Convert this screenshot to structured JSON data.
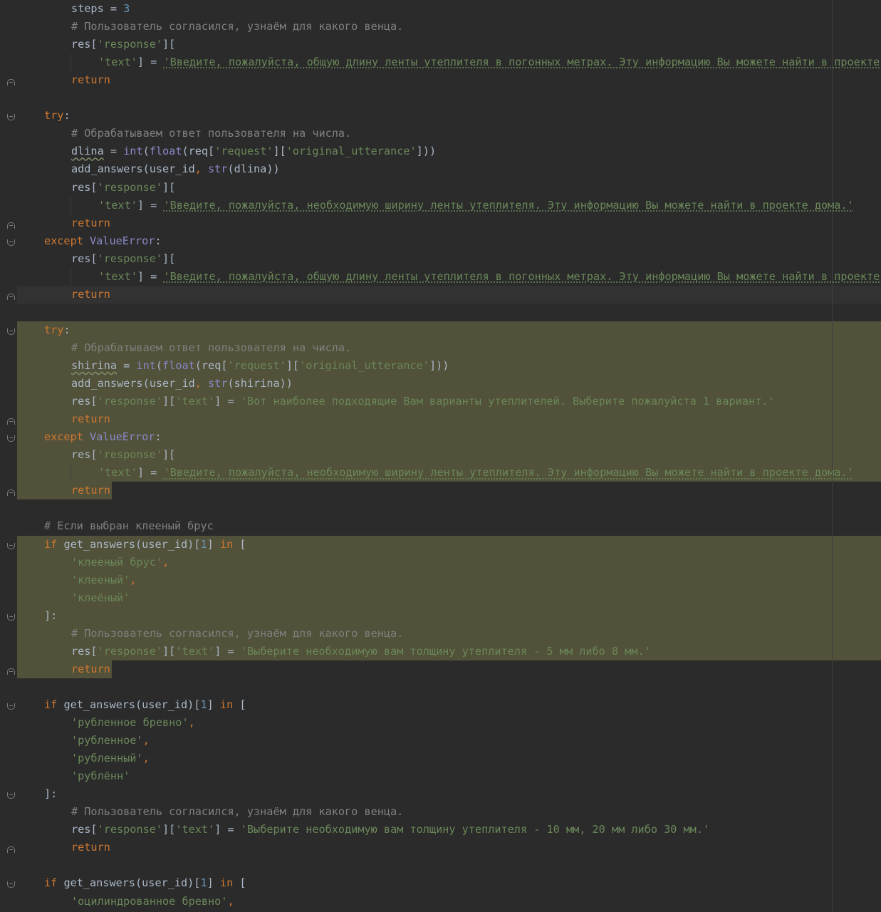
{
  "editor": {
    "language": "python",
    "lines": [
      {
        "indent": 2,
        "tokens": [
          [
            "",
            "steps "
          ],
          [
            "",
            "= "
          ],
          [
            "num",
            "3"
          ]
        ]
      },
      {
        "indent": 2,
        "tokens": [
          [
            "cmt",
            "# Пользователь согласился, узнаём для какого венца."
          ]
        ]
      },
      {
        "indent": 2,
        "tokens": [
          [
            "",
            "res["
          ],
          [
            "str",
            "'response'"
          ],
          [
            "",
            "]["
          ]
        ]
      },
      {
        "indent": 3,
        "tokens": [
          [
            "str",
            "'text'"
          ],
          [
            "",
            "] = "
          ],
          [
            "str und",
            "'Введите, пожалуйста, общую длину ленты утеплителя в погонных метрах. Эту информацию Вы можете найти в проекте дома'"
          ]
        ]
      },
      {
        "indent": 2,
        "tokens": [
          [
            "kw",
            "return"
          ]
        ]
      },
      {
        "indent": 0,
        "tokens": []
      },
      {
        "indent": 1,
        "tokens": [
          [
            "kw",
            "try"
          ],
          [
            "",
            ":"
          ]
        ]
      },
      {
        "indent": 2,
        "tokens": [
          [
            "cmt",
            "# Обрабатываем ответ пользователя на числа."
          ]
        ]
      },
      {
        "indent": 2,
        "tokens": [
          [
            "warn",
            "dlina"
          ],
          [
            "",
            " = "
          ],
          [
            "bi",
            "int"
          ],
          [
            "",
            "("
          ],
          [
            "bi",
            "float"
          ],
          [
            "",
            "(req["
          ],
          [
            "str",
            "'request'"
          ],
          [
            "",
            "]["
          ],
          [
            "str",
            "'original_utterance'"
          ],
          [
            "",
            "]))"
          ]
        ]
      },
      {
        "indent": 2,
        "tokens": [
          [
            "",
            "add_answers(user_id"
          ],
          [
            "kw",
            ", "
          ],
          [
            "bi",
            "str"
          ],
          [
            "",
            "(dlina))"
          ]
        ]
      },
      {
        "indent": 2,
        "tokens": [
          [
            "",
            "res["
          ],
          [
            "str",
            "'response'"
          ],
          [
            "",
            "]["
          ]
        ]
      },
      {
        "indent": 3,
        "tokens": [
          [
            "str",
            "'text'"
          ],
          [
            "",
            "] = "
          ],
          [
            "str und",
            "'Введите, пожалуйста, необходимую ширину ленты утеплителя. Эту информацию Вы можете найти в проекте дома.'"
          ]
        ]
      },
      {
        "indent": 2,
        "tokens": [
          [
            "kw",
            "return"
          ]
        ]
      },
      {
        "indent": 1,
        "tokens": [
          [
            "kw",
            "except "
          ],
          [
            "bi",
            "ValueError"
          ],
          [
            "",
            ":"
          ]
        ]
      },
      {
        "indent": 2,
        "tokens": [
          [
            "",
            "res["
          ],
          [
            "str",
            "'response'"
          ],
          [
            "",
            "]["
          ]
        ]
      },
      {
        "indent": 3,
        "tokens": [
          [
            "str",
            "'text'"
          ],
          [
            "",
            "] = "
          ],
          [
            "str und",
            "'Введите, пожалуйста, общую длину ленты утеплителя в погонных метрах. Эту информацию Вы можете найти в проекте дома'"
          ]
        ]
      },
      {
        "indent": 2,
        "tokens": [
          [
            "kw",
            "return"
          ]
        ]
      },
      {
        "indent": 0,
        "tokens": []
      },
      {
        "indent": 1,
        "tokens": [
          [
            "kw",
            "try"
          ],
          [
            "",
            ":"
          ]
        ]
      },
      {
        "indent": 2,
        "tokens": [
          [
            "cmt",
            "# Обрабатываем ответ пользователя на числа."
          ]
        ]
      },
      {
        "indent": 2,
        "tokens": [
          [
            "warn",
            "shirina"
          ],
          [
            "",
            " = "
          ],
          [
            "bi",
            "int"
          ],
          [
            "",
            "("
          ],
          [
            "bi",
            "float"
          ],
          [
            "",
            "(req["
          ],
          [
            "str",
            "'request'"
          ],
          [
            "",
            "]["
          ],
          [
            "str",
            "'original_utterance'"
          ],
          [
            "",
            "]))"
          ]
        ]
      },
      {
        "indent": 2,
        "tokens": [
          [
            "",
            "add_answers(user_id"
          ],
          [
            "kw",
            ", "
          ],
          [
            "bi",
            "str"
          ],
          [
            "",
            "(shirina))"
          ]
        ]
      },
      {
        "indent": 2,
        "tokens": [
          [
            "",
            "res["
          ],
          [
            "str",
            "'response'"
          ],
          [
            "",
            "]["
          ],
          [
            "str",
            "'text'"
          ],
          [
            "",
            "] = "
          ],
          [
            "str",
            "'Вот наиболее подходящие Вам варианты утеплителей. Выберите пожалуйста 1 вариант.'"
          ]
        ]
      },
      {
        "indent": 2,
        "tokens": [
          [
            "kw",
            "return"
          ]
        ]
      },
      {
        "indent": 1,
        "tokens": [
          [
            "kw",
            "except "
          ],
          [
            "bi",
            "ValueError"
          ],
          [
            "",
            ":"
          ]
        ]
      },
      {
        "indent": 2,
        "tokens": [
          [
            "",
            "res["
          ],
          [
            "str",
            "'response'"
          ],
          [
            "",
            "]["
          ]
        ]
      },
      {
        "indent": 3,
        "tokens": [
          [
            "str",
            "'text'"
          ],
          [
            "",
            "] = "
          ],
          [
            "str und",
            "'Введите, пожалуйста, необходимую ширину ленты утеплителя. Эту информацию Вы можете найти в проекте дома.'"
          ]
        ]
      },
      {
        "indent": 2,
        "tokens": [
          [
            "kw",
            "return"
          ]
        ]
      },
      {
        "indent": 0,
        "tokens": []
      },
      {
        "indent": 1,
        "tokens": [
          [
            "cmt",
            "# Если выбран клееный брус"
          ]
        ]
      },
      {
        "indent": 1,
        "tokens": [
          [
            "kw",
            "if "
          ],
          [
            "",
            "get_answers(user_id)["
          ],
          [
            "num",
            "1"
          ],
          [
            "",
            "] "
          ],
          [
            "kw",
            "in "
          ],
          [
            "",
            "["
          ]
        ]
      },
      {
        "indent": 2,
        "tokens": [
          [
            "str",
            "'клееный брус'"
          ],
          [
            "kw",
            ","
          ]
        ]
      },
      {
        "indent": 2,
        "tokens": [
          [
            "str",
            "'клееный'"
          ],
          [
            "kw",
            ","
          ]
        ]
      },
      {
        "indent": 2,
        "tokens": [
          [
            "str",
            "'клеёный'"
          ]
        ]
      },
      {
        "indent": 1,
        "tokens": [
          [
            "",
            "]:"
          ]
        ]
      },
      {
        "indent": 2,
        "tokens": [
          [
            "cmt",
            "# Пользователь согласился, узнаём для какого венца."
          ]
        ]
      },
      {
        "indent": 2,
        "tokens": [
          [
            "",
            "res["
          ],
          [
            "str",
            "'response'"
          ],
          [
            "",
            "]["
          ],
          [
            "str",
            "'text'"
          ],
          [
            "",
            "] = "
          ],
          [
            "str",
            "'Выберите необходимую вам толщину утеплителя - 5 мм либо 8 мм.'"
          ]
        ]
      },
      {
        "indent": 2,
        "tokens": [
          [
            "kw",
            "return"
          ]
        ]
      },
      {
        "indent": 0,
        "tokens": []
      },
      {
        "indent": 1,
        "tokens": [
          [
            "kw",
            "if "
          ],
          [
            "",
            "get_answers(user_id)["
          ],
          [
            "num",
            "1"
          ],
          [
            "",
            "] "
          ],
          [
            "kw",
            "in "
          ],
          [
            "",
            "["
          ]
        ]
      },
      {
        "indent": 2,
        "tokens": [
          [
            "str",
            "'рубленное бревно'"
          ],
          [
            "kw",
            ","
          ]
        ]
      },
      {
        "indent": 2,
        "tokens": [
          [
            "str",
            "'рубленное'"
          ],
          [
            "kw",
            ","
          ]
        ]
      },
      {
        "indent": 2,
        "tokens": [
          [
            "str",
            "'рубленный'"
          ],
          [
            "kw",
            ","
          ]
        ]
      },
      {
        "indent": 2,
        "tokens": [
          [
            "str",
            "'рублённ'"
          ]
        ]
      },
      {
        "indent": 1,
        "tokens": [
          [
            "",
            "]:"
          ]
        ]
      },
      {
        "indent": 2,
        "tokens": [
          [
            "cmt",
            "# Пользователь согласился, узнаём для какого венца."
          ]
        ]
      },
      {
        "indent": 2,
        "tokens": [
          [
            "",
            "res["
          ],
          [
            "str",
            "'response'"
          ],
          [
            "",
            "]["
          ],
          [
            "str",
            "'text'"
          ],
          [
            "",
            "] = "
          ],
          [
            "str",
            "'Выберите необходимую вам толщину утеплителя - 10 мм, 20 мм либо 30 мм.'"
          ]
        ]
      },
      {
        "indent": 2,
        "tokens": [
          [
            "kw",
            "return"
          ]
        ]
      },
      {
        "indent": 0,
        "tokens": []
      },
      {
        "indent": 1,
        "tokens": [
          [
            "kw",
            "if "
          ],
          [
            "",
            "get_answers(user_id)["
          ],
          [
            "num",
            "1"
          ],
          [
            "",
            "] "
          ],
          [
            "kw",
            "in "
          ],
          [
            "",
            "["
          ]
        ]
      },
      {
        "indent": 2,
        "tokens": [
          [
            "str",
            "'оцилиндрованное бревно'"
          ],
          [
            "kw",
            ","
          ]
        ]
      }
    ]
  },
  "colors": {
    "background": "#2b2b2b",
    "keyword": "#cc7832",
    "string": "#6a8759",
    "comment": "#808080",
    "number": "#6897bb",
    "builtin": "#8888c6",
    "identifier": "#a9b7c6",
    "highlight": "#525139"
  },
  "icons": [
    "fold-open-icon",
    "fold-close-icon"
  ]
}
